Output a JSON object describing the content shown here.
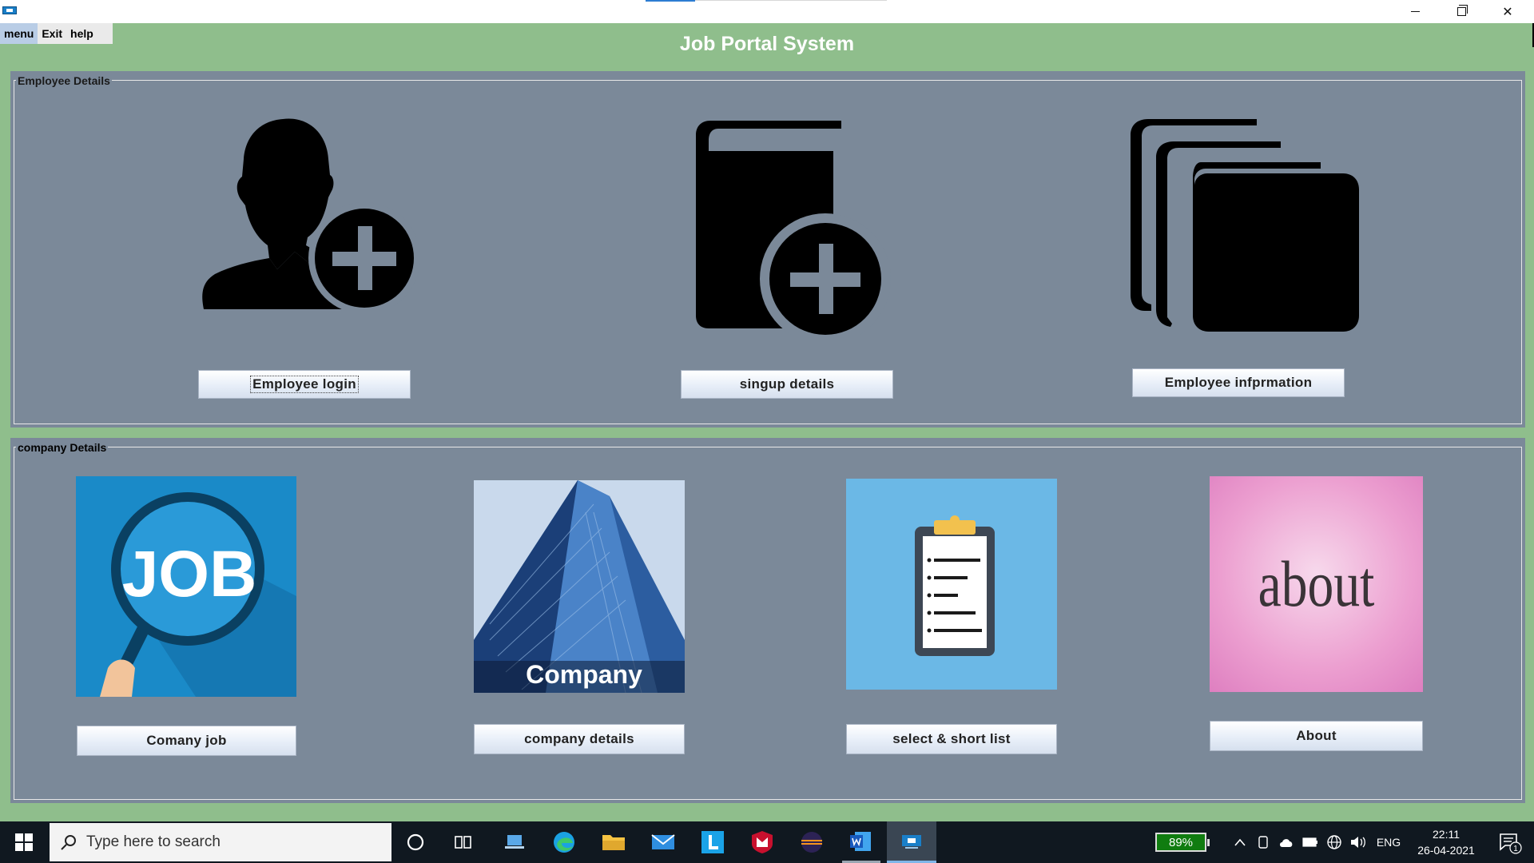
{
  "window": {
    "title": "Job Portal System",
    "controls": {
      "minimize": "minimize",
      "maximize": "restore",
      "close": "✕"
    }
  },
  "menubar": {
    "items": [
      "menu",
      "Exit",
      "help"
    ]
  },
  "employee_panel": {
    "legend": "Employee Details",
    "buttons": {
      "login": "Employee login",
      "signup": "singup details",
      "info": "Employee infprmation"
    }
  },
  "company_panel": {
    "legend": "company Details",
    "tiles": {
      "job_text": "JOB",
      "company_text": "Company",
      "about_text": "about"
    },
    "buttons": {
      "job": "Comany job",
      "details": "company details",
      "select": "select & short list",
      "about": "About"
    }
  },
  "taskbar": {
    "search_placeholder": "Type here to search",
    "battery": "89%",
    "language": "ENG",
    "time": "22:11",
    "date": "26-04-2021",
    "notification_count": "1",
    "pinned_icons": [
      "windows-start-icon",
      "search-icon",
      "cortana-icon",
      "task-view-icon",
      "laptop-icon",
      "edge-icon",
      "file-explorer-icon",
      "mail-icon",
      "l-app-icon",
      "mcafee-icon",
      "eclipse-icon",
      "word-icon",
      "java-app-icon"
    ]
  },
  "colors": {
    "background_green": "#8fbe8c",
    "panel_gray": "#7b8999",
    "title_white": "#ffffff",
    "taskbar": "#101820"
  }
}
